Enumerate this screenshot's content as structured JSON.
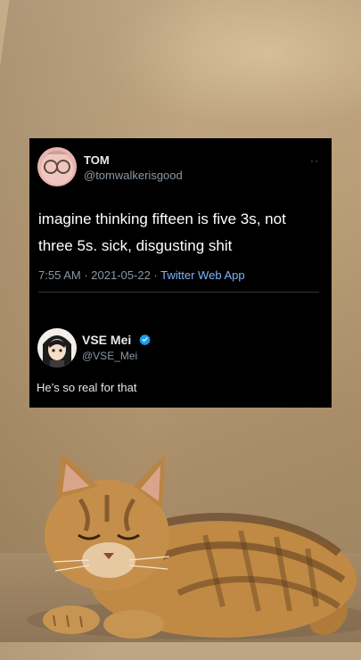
{
  "tweet": {
    "author_name": "TOM",
    "author_handle": "@tomwalkerisgood",
    "more_icon": "more-icon",
    "text": "imagine thinking fifteen is five 3s, not three 5s. sick, disgusting shit",
    "time": "7:55 AM",
    "date": "2021-05-22",
    "separator": "·",
    "source": "Twitter Web App"
  },
  "reply": {
    "author_name": "VSE Mei",
    "author_handle": "@VSE_Mei",
    "verified_icon": "verified-badge-icon",
    "text": "He’s so real for that"
  },
  "colors": {
    "card_bg": "#000000",
    "link": "#7fb4ff",
    "verified": "#1d9bf0",
    "muted": "#8b98a5"
  }
}
